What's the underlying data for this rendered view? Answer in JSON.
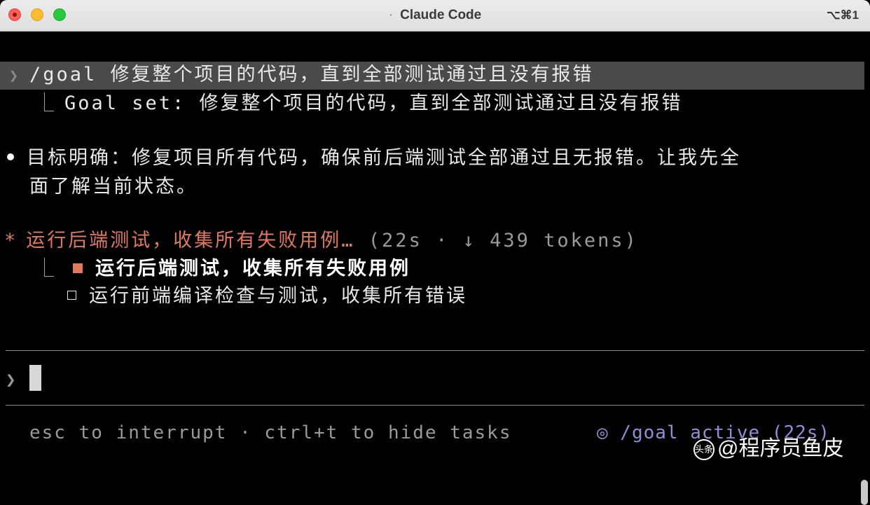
{
  "window": {
    "title": "Claude Code",
    "shortcut": "⌥⌘1"
  },
  "transcript": {
    "command": "/goal 修复整个项目的代码，直到全部测试通过且没有报错",
    "goal_set": "Goal set: 修复整个项目的代码，直到全部测试通过且没有报错",
    "assistant_line1": "目标明确：修复项目所有代码，确保前后端测试全部通过且无报错。让我先全",
    "assistant_line2": "面了解当前状态。",
    "status_task": "运行后端测试，收集所有失败用例…",
    "status_meta": "(22s · ↓ 439 tokens)",
    "tasks": [
      {
        "label": "运行后端测试，收集所有失败用例",
        "state": "in_progress"
      },
      {
        "label": "运行前端编译检查与测试，收集所有错误",
        "state": "pending"
      }
    ]
  },
  "input": {
    "prompt_symbol": "❯",
    "value": ""
  },
  "footer": {
    "hints": "esc to interrupt · ctrl+t to hide tasks",
    "goal_status": "◎ /goal active (22s)"
  },
  "watermark": {
    "icon": "头条",
    "text": "@程序员鱼皮"
  },
  "colors": {
    "accent": "#e07a5f",
    "goal": "#8f8fd6",
    "highlight_bg": "#4a4a4a"
  }
}
